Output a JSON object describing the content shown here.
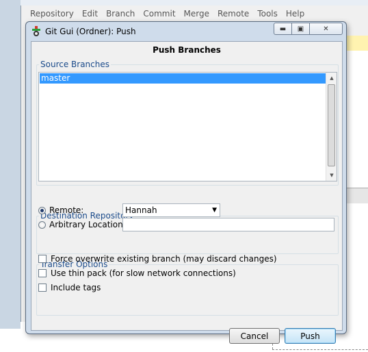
{
  "background": {
    "menu": [
      "Repository",
      "Edit",
      "Branch",
      "Commit",
      "Merge",
      "Remote",
      "Tools",
      "Help"
    ]
  },
  "dialog": {
    "title": "Git Gui (Ordner): Push",
    "heading": "Push Branches",
    "source_branches": {
      "legend": "Source Branches",
      "items": [
        "master"
      ],
      "selected": "master"
    },
    "destination": {
      "legend": "Destination Repository",
      "remote_label": "Remote:",
      "remote_value": "Hannah",
      "arbitrary_label": "Arbitrary Location:",
      "arbitrary_value": "",
      "selected_option": "remote"
    },
    "transfer_options": {
      "legend": "Transfer Options",
      "force": "Force overwrite existing branch (may discard changes)",
      "thin_pack": "Use thin pack (for slow network connections)",
      "include_tags": "Include tags"
    },
    "buttons": {
      "cancel": "Cancel",
      "push": "Push"
    }
  },
  "colors": {
    "selection": "#3399ff",
    "legend_text": "#1a4a8a",
    "window_frame": "#cfdceb"
  }
}
